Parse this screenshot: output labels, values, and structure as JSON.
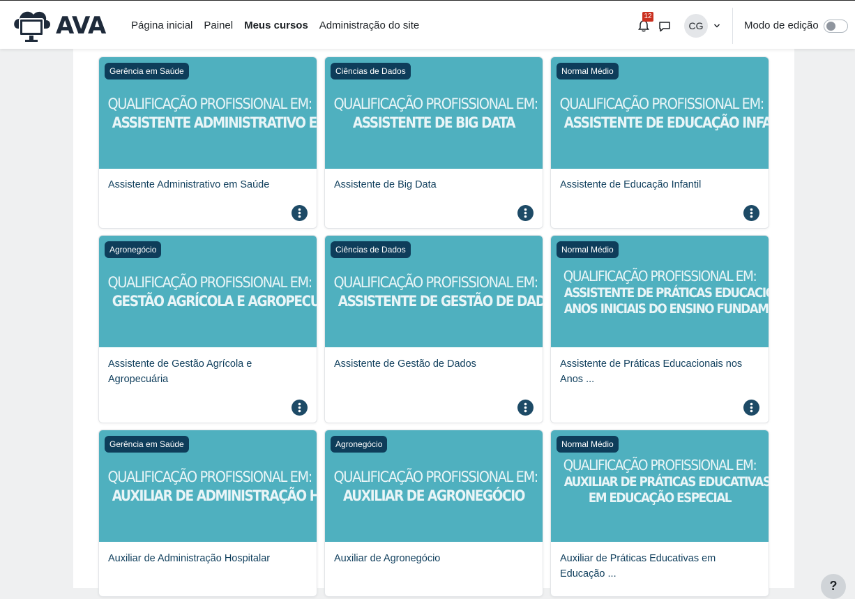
{
  "brand": {
    "name": "AVA",
    "logo_icon": "cloud-monitor-icon"
  },
  "nav": {
    "items": [
      {
        "label": "Página inicial",
        "active": false
      },
      {
        "label": "Painel",
        "active": false
      },
      {
        "label": "Meus cursos",
        "active": true
      },
      {
        "label": "Administração do site",
        "active": false
      }
    ]
  },
  "user_menu": {
    "notification_count": "12",
    "avatar_initials": "CG",
    "edit_mode_label": "Modo de edição",
    "edit_mode_on": false
  },
  "courses": [
    {
      "category": "Gerência em Saúde",
      "banner_line1": "QUALIFICAÇÃO PROFISSIONAL EM:",
      "banner_line2": "ASSISTENTE ADMINISTRATIVO EM SAÚDE",
      "banner_line3": "",
      "title": "Assistente Administrativo em Saúde"
    },
    {
      "category": "Ciências de Dados",
      "banner_line1": "QUALIFICAÇÃO PROFISSIONAL EM:",
      "banner_line2": "ASSISTENTE DE BIG DATA",
      "banner_line3": "",
      "title": "Assistente de Big Data"
    },
    {
      "category": "Normal Médio",
      "banner_line1": "QUALIFICAÇÃO PROFISSIONAL EM:",
      "banner_line2": "ASSISTENTE DE EDUCAÇÃO INFANTIL",
      "banner_line3": "",
      "title": "Assistente de Educação Infantil"
    },
    {
      "category": "Agronegócio",
      "banner_line1": "QUALIFICAÇÃO PROFISSIONAL EM:",
      "banner_line2": "GESTÃO AGRÍCOLA E AGROPECUÁRIA",
      "banner_line3": "",
      "title": "Assistente de Gestão Agrícola e Agropecuária"
    },
    {
      "category": "Ciências de Dados",
      "banner_line1": "QUALIFICAÇÃO PROFISSIONAL EM:",
      "banner_line2": "ASSISTENTE DE GESTÃO DE DADOS",
      "banner_line3": "",
      "title": "Assistente de Gestão de Dados"
    },
    {
      "category": "Normal Médio",
      "banner_line1": "QUALIFICAÇÃO PROFISSIONAL EM:",
      "banner_line2": "ASSISTENTE DE PRÁTICAS EDUCACIONAIS",
      "banner_line3": "ANOS INICIAIS DO ENSINO FUNDAMENTAL",
      "title": "Assistente de Práticas Educacionais nos Anos ..."
    },
    {
      "category": "Gerência em Saúde",
      "banner_line1": "QUALIFICAÇÃO PROFISSIONAL EM:",
      "banner_line2": "AUXILIAR DE ADMINISTRAÇÃO HOSPITALAR",
      "banner_line3": "",
      "title": "Auxiliar de Administração Hospitalar"
    },
    {
      "category": "Agronegócio",
      "banner_line1": "QUALIFICAÇÃO PROFISSIONAL EM:",
      "banner_line2": "AUXILIAR DE AGRONEGÓCIO",
      "banner_line3": "",
      "title": "Auxiliar de Agronegócio"
    },
    {
      "category": "Normal Médio",
      "banner_line1": "QUALIFICAÇÃO PROFISSIONAL EM:",
      "banner_line2": "AUXILIAR DE PRÁTICAS EDUCATIVAS",
      "banner_line3": "EM EDUCAÇÃO ESPECIAL",
      "title": "Auxiliar de Práticas Educativas em Educação ..."
    }
  ],
  "help": {
    "label": "?"
  },
  "colors": {
    "banner_bg": "#4fb0bf",
    "badge_bg": "#0e3d5a",
    "title_color": "#0f3e5c",
    "notification_badge": "#ca3120"
  }
}
